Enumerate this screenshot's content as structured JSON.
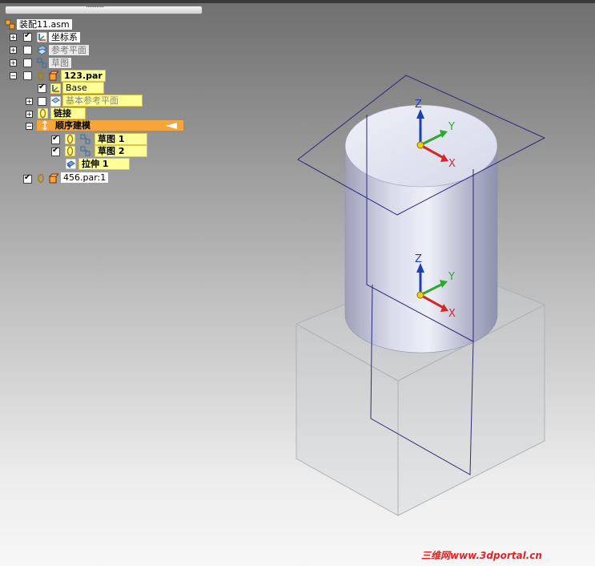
{
  "tree": {
    "root": {
      "label": "装配11.asm",
      "icon": "assembly-icon"
    },
    "items": [
      {
        "label": "坐标系",
        "icon": "coordinate-system-icon",
        "checked": true
      },
      {
        "label": "参考平面",
        "icon": "reference-plane-icon",
        "checked": false
      },
      {
        "label": "草图",
        "icon": "sketch-icon",
        "checked": false
      },
      {
        "label": "123.par",
        "icon": "part-icon",
        "checked": true
      },
      {
        "label": "Base",
        "icon": "base-coordinate-icon",
        "checked": true
      },
      {
        "label": "基本参考平面",
        "icon": "base-plane-icon",
        "checked": false
      },
      {
        "label": "链接",
        "icon": "link-icon"
      },
      {
        "label": "顺序建模",
        "icon": "ordered-modeling-icon"
      },
      {
        "label": "草图 1",
        "icon": "sketch-icon",
        "checked": true
      },
      {
        "label": "草图 2",
        "icon": "sketch-icon",
        "checked": true
      },
      {
        "label": "拉伸 1",
        "icon": "extrude-icon"
      },
      {
        "label": "456.par:1",
        "icon": "part-icon",
        "checked": true
      }
    ]
  },
  "viewport": {
    "triad_top": {
      "z": "Z",
      "y": "Y",
      "x": "X"
    },
    "triad_mid": {
      "z": "Z",
      "y": "Y",
      "x": "X"
    },
    "colors": {
      "z": "#1f3fb4",
      "y": "#2ea82e",
      "x": "#d42828",
      "origin": "#f2d000",
      "edge": "#2b2b7a"
    }
  },
  "watermark": "三维网www.3dportal.cn"
}
